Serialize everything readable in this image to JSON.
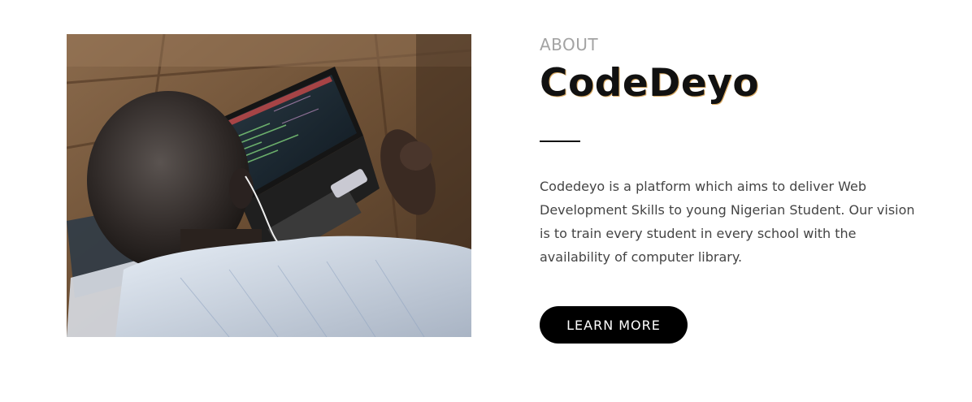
{
  "about": {
    "eyebrow": "ABOUT",
    "title": "CodeDeyo",
    "description": "Codedeyo is a platform which aims to deliver Web Development Skills to young Nigerian Student. Our vision is to train every student in every school with the availability of computer library.",
    "button_label": "LEARN MORE"
  },
  "image": {
    "semantic": "student-using-laptop-photo"
  }
}
